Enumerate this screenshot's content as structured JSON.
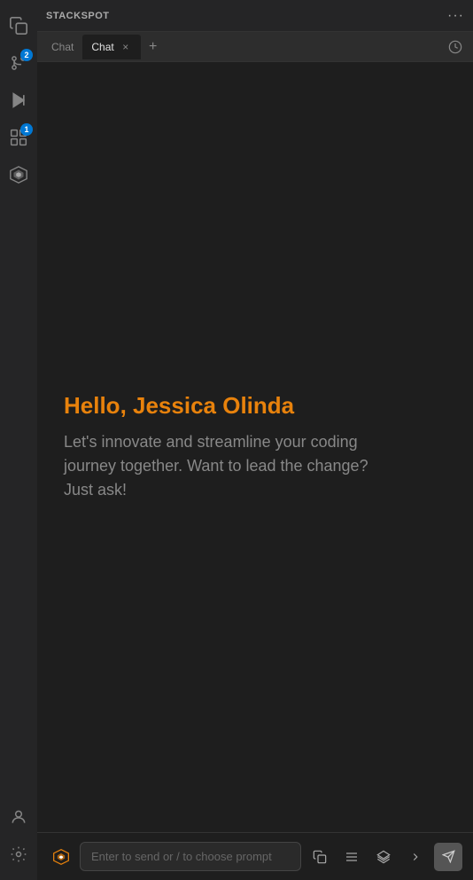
{
  "header": {
    "title": "STACKSPOT",
    "more_icon": "ellipsis-icon"
  },
  "tabs": {
    "inactive_label": "Chat",
    "active_label": "Chat",
    "close_symbol": "×",
    "add_symbol": "+",
    "history_icon": "history-icon"
  },
  "greeting": {
    "name_prefix": "Hello, Jessica Olinda",
    "subtitle": "Let's innovate and streamline your coding journey together. Want to lead the change? Just ask!"
  },
  "input": {
    "placeholder": "Enter to send or / to choose prompt",
    "send_icon": "send-icon"
  },
  "sidebar": {
    "icons": [
      {
        "name": "copy-icon",
        "symbol": "⧉",
        "badge": null
      },
      {
        "name": "source-control-icon",
        "symbol": "⑂",
        "badge": "2"
      },
      {
        "name": "run-icon",
        "symbol": "▷",
        "badge": null
      },
      {
        "name": "extensions-icon",
        "symbol": "⊞",
        "badge": "1"
      },
      {
        "name": "stackspot-icon",
        "symbol": "✦",
        "badge": null
      }
    ],
    "bottom_icons": [
      {
        "name": "account-icon",
        "symbol": "👤"
      },
      {
        "name": "settings-icon",
        "symbol": "⚙"
      }
    ]
  }
}
